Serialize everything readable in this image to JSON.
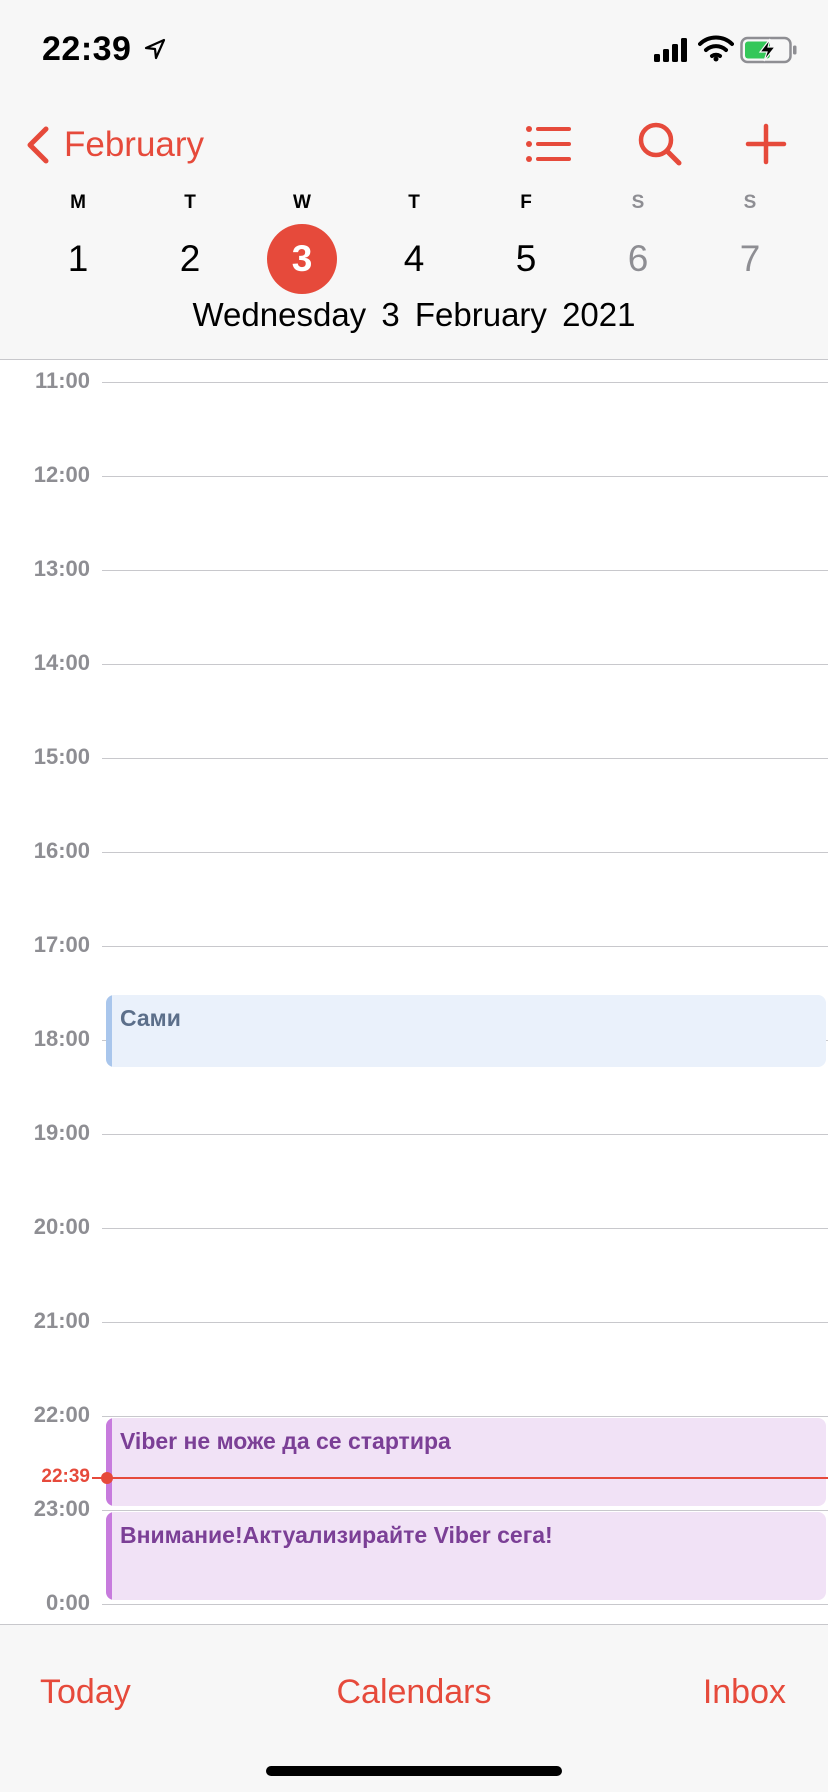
{
  "status_bar": {
    "time": "22:39",
    "icons": [
      "location-arrow-icon",
      "cellular-signal-icon",
      "wifi-icon",
      "battery-charging-icon"
    ]
  },
  "header": {
    "back_label": "February",
    "icons": [
      "list-icon",
      "search-icon",
      "add-icon"
    ]
  },
  "week": {
    "days": [
      {
        "dow": "M",
        "num": "1",
        "weekend": false,
        "selected": false
      },
      {
        "dow": "T",
        "num": "2",
        "weekend": false,
        "selected": false
      },
      {
        "dow": "W",
        "num": "3",
        "weekend": false,
        "selected": true
      },
      {
        "dow": "T",
        "num": "4",
        "weekend": false,
        "selected": false
      },
      {
        "dow": "F",
        "num": "5",
        "weekend": false,
        "selected": false
      },
      {
        "dow": "S",
        "num": "6",
        "weekend": true,
        "selected": false
      },
      {
        "dow": "S",
        "num": "7",
        "weekend": true,
        "selected": false
      }
    ],
    "full_date": "Wednesday  3 February 2021"
  },
  "timeline": {
    "hours": [
      "11:00",
      "12:00",
      "13:00",
      "14:00",
      "15:00",
      "16:00",
      "17:00",
      "18:00",
      "19:00",
      "20:00",
      "21:00",
      "22:00",
      "23:00",
      "0:00"
    ],
    "now_label": "22:39",
    "events": [
      {
        "title": "Сами",
        "color": "#a9c6ec"
      },
      {
        "title": "Viber не може да се стартира",
        "color": "#c77bdd"
      },
      {
        "title": "Внимание!Актуализирайте Viber сега!",
        "color": "#c77bdd"
      }
    ]
  },
  "tabbar": {
    "today": "Today",
    "calendars": "Calendars",
    "inbox": "Inbox"
  },
  "colors": {
    "accent": "#e64a3b",
    "background": "#f7f7f7"
  }
}
